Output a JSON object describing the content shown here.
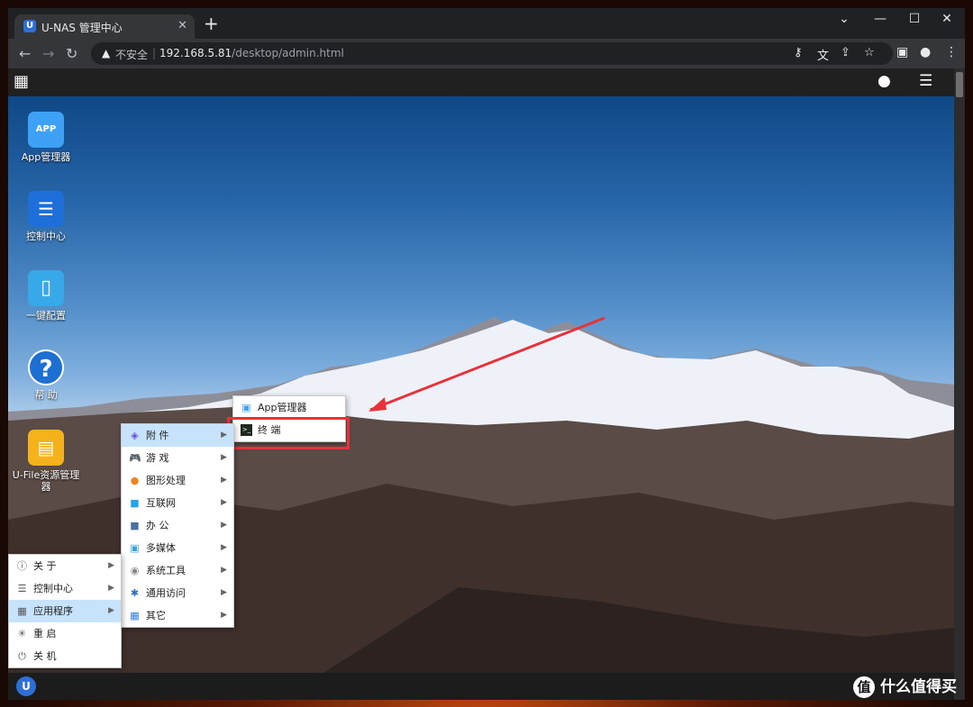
{
  "browser": {
    "tab_title": "U-NAS 管理中心",
    "tab_favicon": "U",
    "close_tab": "✕",
    "new_tab": "+",
    "window_controls": {
      "minimize": "⌄",
      "maximize": "☐",
      "restore": "—",
      "close": "✕"
    },
    "nav": {
      "back": "←",
      "forward": "→",
      "reload": "↻"
    },
    "security_label": "不安全",
    "security_icon": "▲",
    "separator": "|",
    "url_host": "192.168.5.81",
    "url_path": "/desktop/admin.html",
    "omni_icons": {
      "key": "⚷",
      "translate": "文",
      "share": "⇪",
      "star": "☆"
    },
    "toolbar_icons": {
      "sidepanel": "▣",
      "profile": "●",
      "menu": "⋮"
    }
  },
  "topbar": {
    "apps_icon": "▦",
    "user_icon": "●",
    "list_icon": "☰"
  },
  "desktop_icons": [
    {
      "label": "App管理器",
      "glyph": "APP",
      "color": "#3da1f5"
    },
    {
      "label": "控制中心",
      "glyph": "☰",
      "color": "#1e6fd9"
    },
    {
      "label": "一键配置",
      "glyph": "▯",
      "color": "#38a9e8"
    },
    {
      "label": "帮 助",
      "glyph": "?",
      "color": "#1d6fd1"
    },
    {
      "label": "U-File资源管理器",
      "glyph": "▤",
      "color": "#f5b21a"
    }
  ],
  "start_menu": [
    {
      "label": "关 于",
      "icon": "ⓘ",
      "arrow": "▶"
    },
    {
      "label": "控制中心",
      "icon": "☰",
      "arrow": "▶"
    },
    {
      "label": "应用程序",
      "icon": "▦",
      "arrow": "▶"
    },
    {
      "label": "重 启",
      "icon": "✳",
      "arrow": ""
    },
    {
      "label": "关 机",
      "icon": "⏻",
      "arrow": ""
    }
  ],
  "apps_menu": [
    {
      "label": "附 件",
      "icon": "◈",
      "color": "#6b4fd8",
      "arrow": "▶"
    },
    {
      "label": "游 戏",
      "icon": "🎮",
      "color": "#333333",
      "arrow": "▶"
    },
    {
      "label": "图形处理",
      "icon": "●",
      "color": "#f0841e",
      "arrow": "▶"
    },
    {
      "label": "互联网",
      "icon": "■",
      "color": "#27a4e8",
      "arrow": "▶"
    },
    {
      "label": "办 公",
      "icon": "■",
      "color": "#4a6fa5",
      "arrow": "▶"
    },
    {
      "label": "多媒体",
      "icon": "▣",
      "color": "#3aa3e3",
      "arrow": "▶"
    },
    {
      "label": "系统工具",
      "icon": "◉",
      "color": "#888888",
      "arrow": "▶"
    },
    {
      "label": "通用访问",
      "icon": "✱",
      "color": "#2b6fc6",
      "arrow": "▶"
    },
    {
      "label": "其它",
      "icon": "▦",
      "color": "#2d7de0",
      "arrow": "▶"
    }
  ],
  "accessories_menu": [
    {
      "label": "App管理器",
      "icon": "▣",
      "color": "#3da1f5"
    },
    {
      "label": "终 端",
      "icon": ">_",
      "color": "#1d2a1d"
    }
  ],
  "taskbar": {
    "start_glyph": "U"
  },
  "watermark": {
    "badge": "值",
    "text": "什么值得买"
  },
  "colors": {
    "highlight": "#c6e3fb",
    "annotation": "#e8313a"
  }
}
